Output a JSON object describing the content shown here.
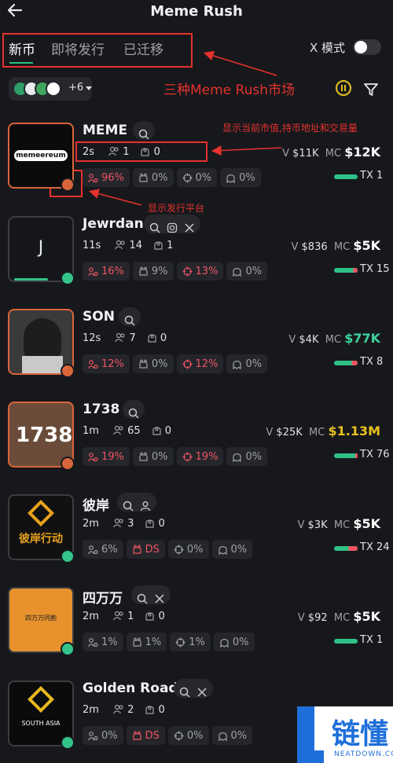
{
  "header": {
    "title": "Meme Rush",
    "back_icon": "arrow-left-icon"
  },
  "tabs": [
    {
      "label": "新币",
      "active": true
    },
    {
      "label": "即将发行",
      "active": false
    },
    {
      "label": "已迁移",
      "active": false
    }
  ],
  "x_mode": {
    "label": "X 模式",
    "enabled": false
  },
  "platform_filter": {
    "count_label": "+6"
  },
  "annotations": {
    "markets": "三种Meme Rush市场",
    "market_cap_info": "显示当前市值,持币地址和交易量",
    "platform_info": "显示发行平台"
  },
  "tokens": [
    {
      "name": "MEME",
      "age": "2s",
      "holders": "1",
      "devs": "0",
      "v_label": "V",
      "volume": "$11K",
      "mc_label": "MC",
      "market_cap": "$12K",
      "mc_color": "#ffffff",
      "stats": [
        "96%",
        "0%",
        "0%",
        "0%"
      ],
      "tx_label": "TX",
      "tx": "1",
      "tx_sell_fraction": 0.0,
      "avatar_text": "memeereum",
      "progress": 0.0
    },
    {
      "name": "Jewrdan",
      "age": "11s",
      "holders": "14",
      "devs": "1",
      "v_label": "V",
      "volume": "$836",
      "mc_label": "MC",
      "market_cap": "$5K",
      "mc_color": "#ffffff",
      "stats": [
        "16%",
        "9%",
        "13%",
        "0%"
      ],
      "tx_label": "TX",
      "tx": "15",
      "tx_sell_fraction": 0.2,
      "avatar_text": "J",
      "progress": 0.6
    },
    {
      "name": "SON",
      "age": "12s",
      "holders": "7",
      "devs": "0",
      "v_label": "V",
      "volume": "$4K",
      "mc_label": "MC",
      "market_cap": "$77K",
      "mc_color": "#3ed39b",
      "stats": [
        "12%",
        "0%",
        "12%",
        "0%"
      ],
      "tx_label": "TX",
      "tx": "8",
      "tx_sell_fraction": 0.25,
      "avatar_text": "",
      "progress": 0.0
    },
    {
      "name": "1738",
      "age": "1m",
      "holders": "65",
      "devs": "0",
      "v_label": "V",
      "volume": "$25K",
      "mc_label": "MC",
      "market_cap": "$1.13M",
      "mc_color": "#e8c01f",
      "stats": [
        "19%",
        "0%",
        "19%",
        "0%"
      ],
      "tx_label": "TX",
      "tx": "76",
      "tx_sell_fraction": 0.1,
      "avatar_text": "1738",
      "progress": 0.0
    },
    {
      "name": "彼岸",
      "age": "2m",
      "holders": "3",
      "devs": "0",
      "v_label": "V",
      "volume": "$3K",
      "mc_label": "MC",
      "market_cap": "$5K",
      "mc_color": "#ffffff",
      "stats": [
        "6%",
        "DS",
        "0%",
        "0%"
      ],
      "tx_label": "TX",
      "tx": "24",
      "tx_sell_fraction": 0.4,
      "avatar_text": "彼岸行动",
      "progress": 0.0
    },
    {
      "name": "四万万",
      "age": "2m",
      "holders": "1",
      "devs": "0",
      "v_label": "V",
      "volume": "$92",
      "mc_label": "MC",
      "market_cap": "$5K",
      "mc_color": "#ffffff",
      "stats": [
        "1%",
        "1%",
        "1%",
        "0%"
      ],
      "tx_label": "TX",
      "tx": "1",
      "tx_sell_fraction": 0.0,
      "avatar_text": "四万万同胞",
      "progress": 0.0
    },
    {
      "name": "Golden Road",
      "age": "2m",
      "holders": "2",
      "devs": "0",
      "v_label": "",
      "volume": "",
      "mc_label": "",
      "market_cap": "",
      "mc_color": "#ffffff",
      "stats": [
        "0%",
        "DS",
        "0%",
        "0%"
      ],
      "tx_label": "",
      "tx": "",
      "tx_sell_fraction": 0.0,
      "avatar_text": "SOUTH ASIA",
      "progress": 0.0
    }
  ],
  "watermark": {
    "cn": "链懂",
    "en": "NEATDOWN.COM"
  }
}
